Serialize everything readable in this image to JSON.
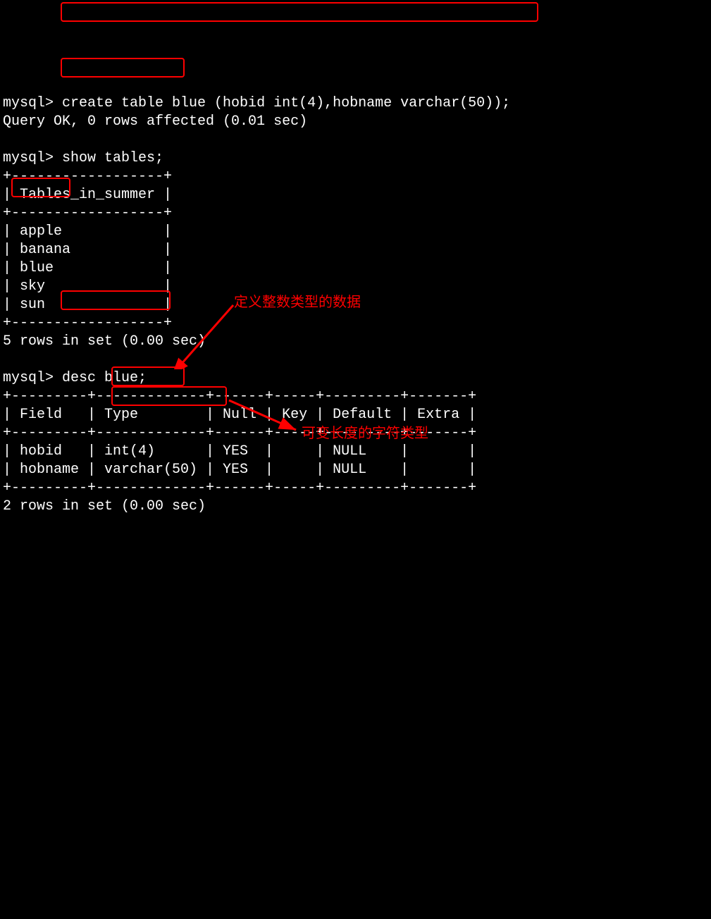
{
  "prompt": "mysql>",
  "cmd1": " create table blue (hobid int(4),hobname varchar(50));",
  "result1": "Query OK, 0 rows affected (0.01 sec)",
  "cmd2": " show tables;",
  "tables_header": "Tables_in_summer",
  "tables": {
    "rows": [
      "apple",
      "banana",
      "blue",
      "sky",
      "sun"
    ]
  },
  "tables_border_top": "+------------------+",
  "tables_row0": "| Tables_in_summer |",
  "tables_row1": "| apple            |",
  "tables_row2": "| banana           |",
  "tables_row3": "| blue             |",
  "tables_row4": "| sky              |",
  "tables_row5": "| sun              |",
  "tables_summary": "5 rows in set (0.00 sec)",
  "cmd3": " desc blue;",
  "desc_border": "+---------+-------------+------+-----+---------+-------+",
  "desc_header": "| Field   | Type        | Null | Key | Default | Extra |",
  "desc_row1": "| hobid   | int(4)      | YES  |     | NULL    |       |",
  "desc_row2": "| hobname | varchar(50) | YES  |     | NULL    |       |",
  "desc_summary": "2 rows in set (0.00 sec)",
  "desc_table": {
    "columns": [
      "Field",
      "Type",
      "Null",
      "Key",
      "Default",
      "Extra"
    ],
    "rows": [
      {
        "Field": "hobid",
        "Type": "int(4)",
        "Null": "YES",
        "Key": "",
        "Default": "NULL",
        "Extra": ""
      },
      {
        "Field": "hobname",
        "Type": "varchar(50)",
        "Null": "YES",
        "Key": "",
        "Default": "NULL",
        "Extra": ""
      }
    ]
  },
  "annotation1": "定义整数类型的数据",
  "annotation2": "可变长度的字符类型",
  "highlight_color": "#ff0000"
}
